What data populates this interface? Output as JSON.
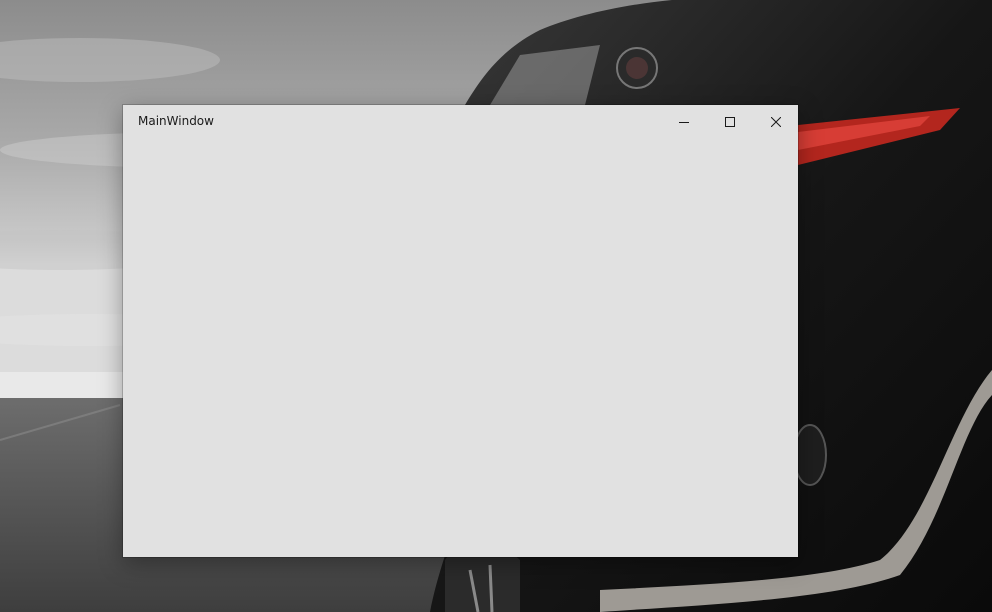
{
  "window": {
    "title": "MainWindow",
    "background_color": "#e1e1e1",
    "caption_buttons": {
      "minimize": {
        "icon": "minimize-icon"
      },
      "maximize": {
        "icon": "maximize-icon"
      },
      "close": {
        "icon": "close-icon"
      }
    }
  },
  "desktop": {
    "wallpaper": "grey-sky-road-dark-sports-car"
  }
}
